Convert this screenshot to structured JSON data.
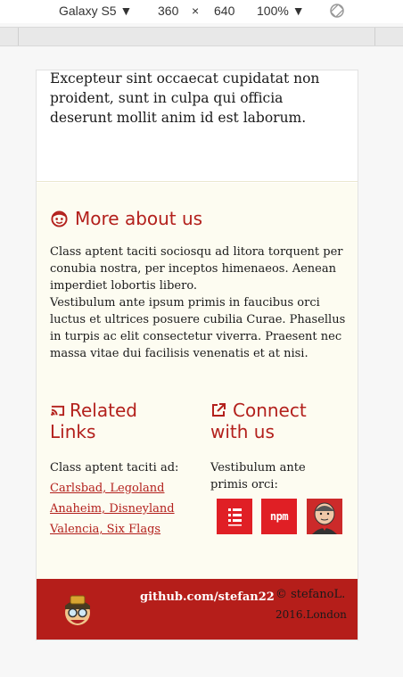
{
  "devtools": {
    "device": "Galaxy S5",
    "width": "360",
    "times": "×",
    "height": "640",
    "zoom": "100%",
    "dropdown_arrow": "▼"
  },
  "page": {
    "intro_text": "Excepteur sint occaecat cupidatat non proident, sunt in culpa qui officia deserunt mollit anim id est laborum.",
    "about": {
      "title": "More about us",
      "paragraph1": "Class aptent taciti sociosqu ad litora torquent per conubia nostra, per inceptos himenaeos. Aenean imperdiet lobortis libero.",
      "paragraph2": "Vestibulum ante ipsum primis in faucibus orci luctus et ultrices posuere cubilia Curae. Phasellus in turpis ac elit consectetur viverra. Praesent nec massa vitae dui facilisis venenatis et at nisi."
    },
    "related": {
      "title_line1": "Related",
      "title_line2": "Links",
      "intro": "Class aptent taciti ad:",
      "links": [
        "Carlsbad, Legoland",
        "Anaheim, Disneyland",
        "Valencia, Six Flags"
      ]
    },
    "connect": {
      "title_line1": "Connect",
      "title_line2": "with us",
      "intro_line1": "Vestibulum ante",
      "intro_line2": "primis orci:",
      "badges": {
        "npm_label": "npm"
      }
    },
    "footer": {
      "github": "github.com/stefan22",
      "copyright_line1": "© stefanoL.",
      "copyright_line2": "2016.London"
    }
  },
  "colors": {
    "accent": "#b3201c",
    "cream": "#fdfcf1",
    "footer": "#b51e1a"
  }
}
